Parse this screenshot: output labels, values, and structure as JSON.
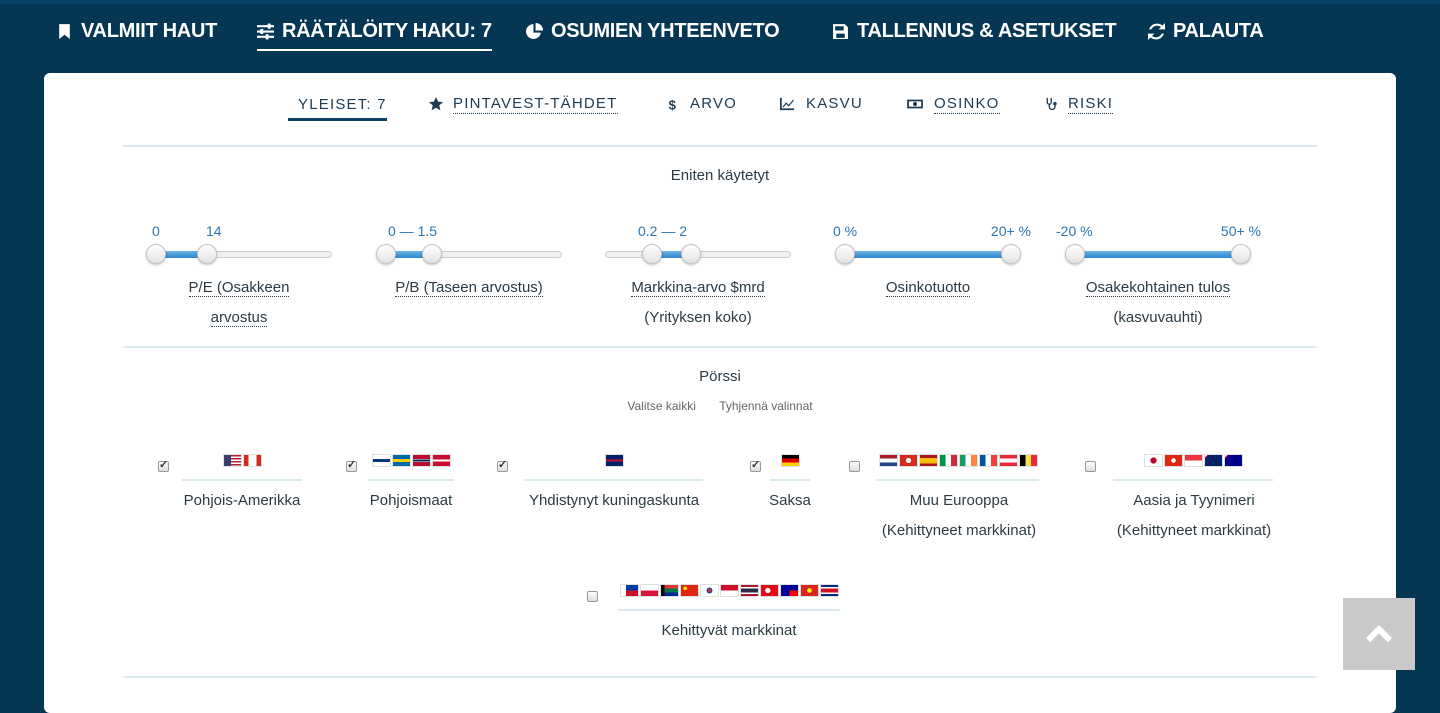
{
  "topnav": {
    "items": [
      {
        "label": "VALMIIT HAUT",
        "icon": "bookmark-icon"
      },
      {
        "label": "RÄÄTÄLÖITY HAKU: 7",
        "icon": "sliders-icon",
        "active": true
      },
      {
        "label": "OSUMIEN YHTEENVETO",
        "icon": "pie-chart-icon"
      },
      {
        "label": "TALLENNUS & ASETUKSET",
        "icon": "save-icon"
      },
      {
        "label": "PALAUTA",
        "icon": "refresh-icon"
      }
    ]
  },
  "subtabs": [
    {
      "label": "YLEISET: 7",
      "active": true
    },
    {
      "label": "PINTAVEST-TÄHDET",
      "icon": "star-icon"
    },
    {
      "label": "ARVO",
      "icon": "dollar-icon"
    },
    {
      "label": "KASVU",
      "icon": "line-chart-icon"
    },
    {
      "label": "OSINKO",
      "icon": "money-icon"
    },
    {
      "label": "RISKI",
      "icon": "stethoscope-icon"
    }
  ],
  "most_used": {
    "title": "Eniten käytetyt",
    "sliders": [
      {
        "min_label": "0",
        "max_label": "14",
        "name_line1": "P/E (Osakkeen",
        "name_line2": "arvostus",
        "low": 0.0,
        "high": 0.31
      },
      {
        "min_label": "0 — 1.5",
        "max_label": "",
        "name_line1": "P/B (Taseen arvostus)",
        "name_line2": "",
        "low": 0.0,
        "high": 0.28
      },
      {
        "min_label": "0.2 — 2",
        "max_label": "",
        "name_line1": "Markkina-arvo $mrd",
        "name_line2": "(Yrityksen koko)",
        "low": 0.22,
        "high": 0.46
      },
      {
        "min_label": "0 %",
        "max_label": "20+ %",
        "name_line1": "Osinkotuotto",
        "name_line2": "",
        "low": 0.0,
        "high": 1.0
      },
      {
        "min_label": "-20 %",
        "max_label": "50+ %",
        "name_line1": "Osakekohtainen tulos",
        "name_line2": "(kasvuvauhti)",
        "low": 0.0,
        "high": 1.0
      }
    ]
  },
  "exchanges": {
    "title": "Pörssi",
    "select_all": "Valitse kaikki",
    "clear": "Tyhjennä valinnat",
    "markets": [
      {
        "label1": "Pohjois-Amerikka",
        "label2": "",
        "checked": true,
        "flags": [
          "us-flag",
          "ca-flag"
        ]
      },
      {
        "label1": "Pohjoismaat",
        "label2": "",
        "checked": true,
        "flags": [
          "fi-flag",
          "se-flag",
          "no-flag",
          "dk-flag"
        ]
      },
      {
        "label1": "Yhdistynyt kuningaskunta",
        "label2": "",
        "checked": true,
        "flags": [
          "gb-flag"
        ]
      },
      {
        "label1": "Saksa",
        "label2": "",
        "checked": true,
        "flags": [
          "de-flag"
        ]
      },
      {
        "label1": "Muu Eurooppa",
        "label2": "(Kehittyneet markkinat)",
        "checked": false,
        "flags": [
          "nl-flag",
          "ch-flag",
          "es-flag",
          "it-flag",
          "ie-flag",
          "fr-flag",
          "at-flag",
          "be-flag"
        ]
      },
      {
        "label1": "Aasia ja Tyynimeri",
        "label2": "(Kehittyneet markkinat)",
        "checked": false,
        "flags": [
          "jp-flag",
          "hk-flag",
          "sg-flag",
          "nz-flag",
          "au-flag"
        ]
      },
      {
        "label1": "Kehittyvät markkinat",
        "label2": "",
        "checked": false,
        "flags": [
          "ph-flag",
          "pl-flag",
          "za-flag",
          "cn-flag",
          "kr-flag",
          "id-flag",
          "th-flag",
          "tr-flag",
          "tw-flag",
          "vn-flag",
          "cr-flag"
        ]
      }
    ]
  },
  "colors": {
    "background": "#053654",
    "accent": "#2a77b5",
    "panel": "#ffffff"
  }
}
